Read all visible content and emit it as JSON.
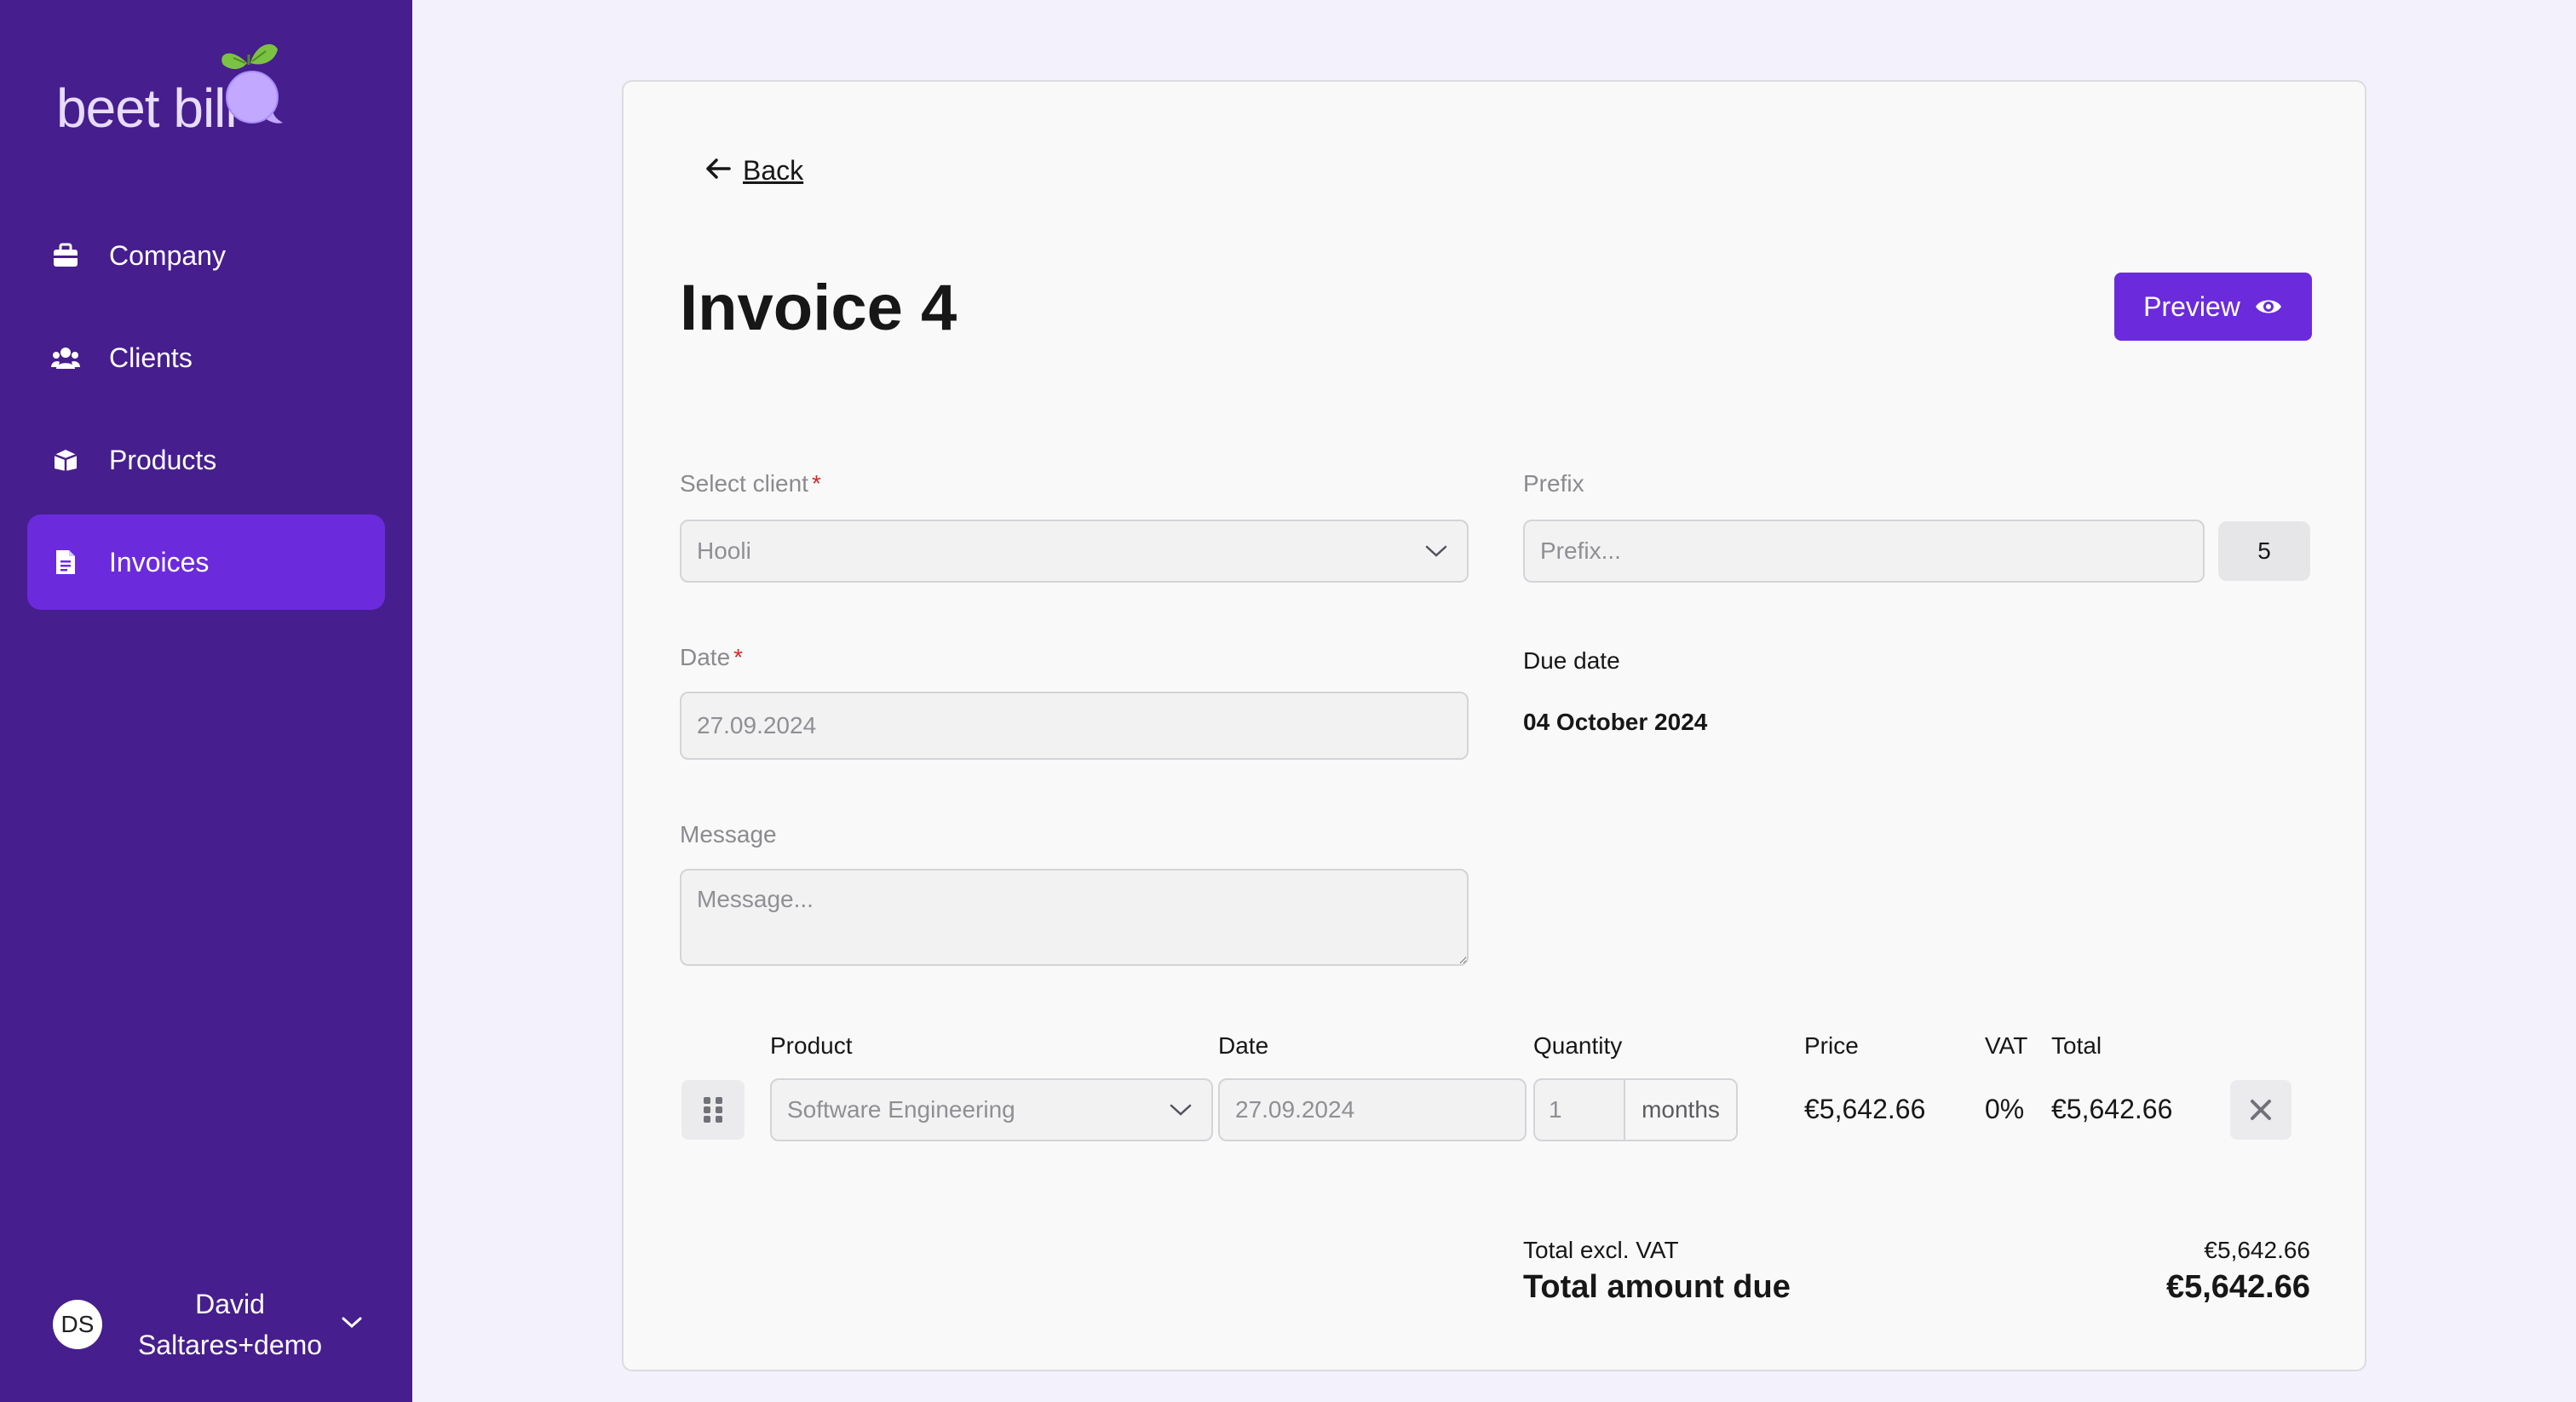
{
  "brand": {
    "name": "beet bill",
    "colors": {
      "sidebar": "#461e8d",
      "accent": "#6b2bdc",
      "logo_leaf": "#7cc242",
      "logo_bubble": "#c2a8ff"
    }
  },
  "sidebar": {
    "items": [
      {
        "label": "Company",
        "icon": "briefcase-icon",
        "active": false
      },
      {
        "label": "Clients",
        "icon": "users-icon",
        "active": false
      },
      {
        "label": "Products",
        "icon": "box-icon",
        "active": false
      },
      {
        "label": "Invoices",
        "icon": "document-icon",
        "active": true
      }
    ],
    "user": {
      "initials": "DS",
      "name": "David Saltares+demo"
    }
  },
  "header": {
    "back_label": "Back",
    "title": "Invoice 4",
    "preview_label": "Preview"
  },
  "form": {
    "client": {
      "label": "Select client",
      "required_mark": "*",
      "value": "Hooli"
    },
    "prefix": {
      "label": "Prefix",
      "placeholder": "Prefix...",
      "number": "5"
    },
    "date": {
      "label": "Date",
      "required_mark": "*",
      "value": "27.09.2024"
    },
    "due_date": {
      "label": "Due date",
      "value": "04 October 2024"
    },
    "message": {
      "label": "Message",
      "placeholder": "Message..."
    }
  },
  "line_items": {
    "columns": {
      "product": "Product",
      "date": "Date",
      "quantity": "Quantity",
      "price": "Price",
      "vat": "VAT",
      "total": "Total"
    },
    "rows": [
      {
        "product": "Software Engineering",
        "date": "27.09.2024",
        "quantity": "1",
        "unit": "months",
        "price": "€5,642.66",
        "vat": "0%",
        "total": "€5,642.66"
      }
    ]
  },
  "totals": {
    "excl_vat_label": "Total excl. VAT",
    "excl_vat_value": "€5,642.66",
    "due_label": "Total amount due",
    "due_value": "€5,642.66"
  }
}
